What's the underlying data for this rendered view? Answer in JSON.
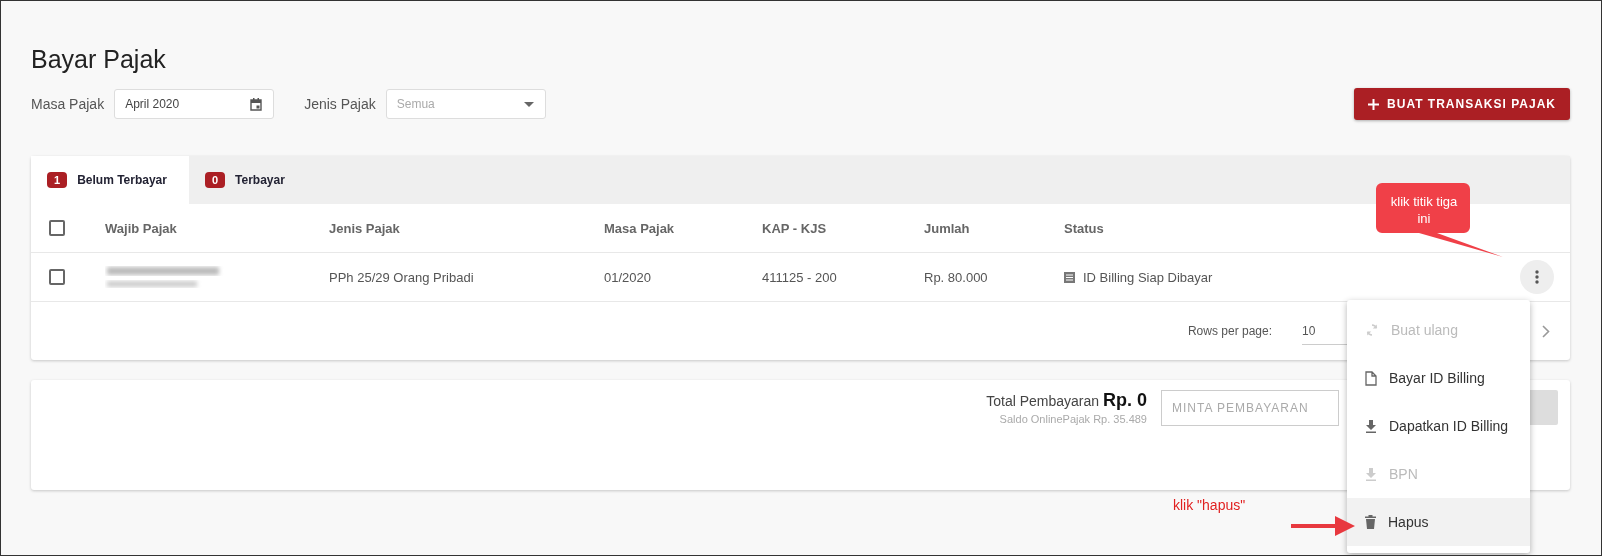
{
  "page": {
    "title": "Bayar Pajak"
  },
  "filters": [
    {
      "label": "Masa Pajak",
      "kind": "date",
      "value": "April 2020"
    },
    {
      "label": "Jenis Pajak",
      "kind": "select",
      "placeholder": "Semua"
    }
  ],
  "create_button": {
    "label": "BUAT TRANSAKSI PAJAK"
  },
  "tabs": [
    {
      "count": "1",
      "label": "Belum Terbayar",
      "selected": true
    },
    {
      "count": "0",
      "label": "Terbayar",
      "selected": false
    }
  ],
  "table": {
    "header_checked": false,
    "columns": [
      "Wajib Pajak",
      "Jenis Pajak",
      "Masa Pajak",
      "KAP - KJS",
      "Jumlah",
      "Status"
    ],
    "rows": [
      {
        "checked": false,
        "jenis_pajak": "PPh 25/29 Orang Pribadi",
        "masa_pajak": "01/2020",
        "kap_kjs": "411125 - 200",
        "jumlah": "Rp. 80.000",
        "status": "ID Billing Siap Dibayar"
      }
    ]
  },
  "pagination": {
    "label": "Rows per page:",
    "value": "10"
  },
  "summary": {
    "label": "Total Pembayaran",
    "amount": "Rp. 0",
    "balance": "Saldo OnlinePajak Rp. 35.489",
    "button": "MINTA PEMBAYARAN"
  },
  "menu": {
    "items": [
      {
        "label": "Buat ulang",
        "kind": "refresh",
        "disabled": true,
        "selected": false
      },
      {
        "label": "Bayar ID Billing",
        "kind": "file",
        "disabled": false,
        "selected": false
      },
      {
        "label": "Dapatkan ID Billing",
        "kind": "download",
        "disabled": false,
        "selected": false
      },
      {
        "label": "BPN",
        "kind": "download",
        "disabled": true,
        "selected": false
      },
      {
        "label": "Hapus",
        "kind": "trash",
        "disabled": false,
        "selected": true
      }
    ]
  },
  "annotations": [
    {
      "kind": "callout",
      "text": "klik titik tiga ini"
    },
    {
      "kind": "arrow-label",
      "text": "klik \"hapus\""
    }
  ]
}
